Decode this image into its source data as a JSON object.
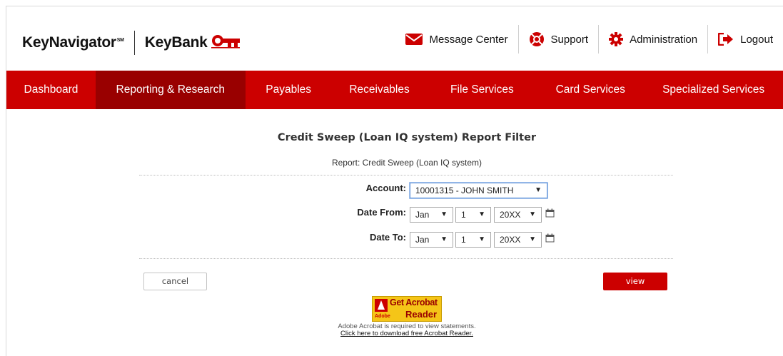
{
  "brand": {
    "keynavigator": "KeyNavigator",
    "sm_mark": "SM",
    "keybank": "KeyBank",
    "accent_color": "#cc0000"
  },
  "topnav": [
    {
      "label": "Message Center",
      "icon": "envelope-icon"
    },
    {
      "label": "Support",
      "icon": "lifebuoy-icon"
    },
    {
      "label": "Administration",
      "icon": "gear-icon"
    },
    {
      "label": "Logout",
      "icon": "logout-icon"
    }
  ],
  "mainnav": [
    {
      "label": "Dashboard",
      "active": false
    },
    {
      "label": "Reporting & Research",
      "active": true
    },
    {
      "label": "Payables",
      "active": false
    },
    {
      "label": "Receivables",
      "active": false
    },
    {
      "label": "File Services",
      "active": false
    },
    {
      "label": "Card Services",
      "active": false
    },
    {
      "label": "Specialized Services",
      "active": false
    }
  ],
  "page": {
    "title": "Credit Sweep (Loan IQ system) Report Filter",
    "subtitle": "Report: Credit Sweep (Loan IQ system)"
  },
  "form": {
    "account_label": "Account:",
    "account_value": "10001315 - JOHN SMITH",
    "date_from_label": "Date From:",
    "date_to_label": "Date To:",
    "date_from": {
      "month": "Jan",
      "day": "1",
      "year": "20XX"
    },
    "date_to": {
      "month": "Jan",
      "day": "1",
      "year": "20XX"
    },
    "dropdown_arrow": "▼"
  },
  "buttons": {
    "cancel": "cancel",
    "view": "view"
  },
  "acrobat": {
    "adobe": "Adobe",
    "get": "Get Acrobat",
    "reader": "Reader",
    "note": "Adobe Acrobat is required to view statements.",
    "link": "Click here to download free Acrobat Reader."
  }
}
